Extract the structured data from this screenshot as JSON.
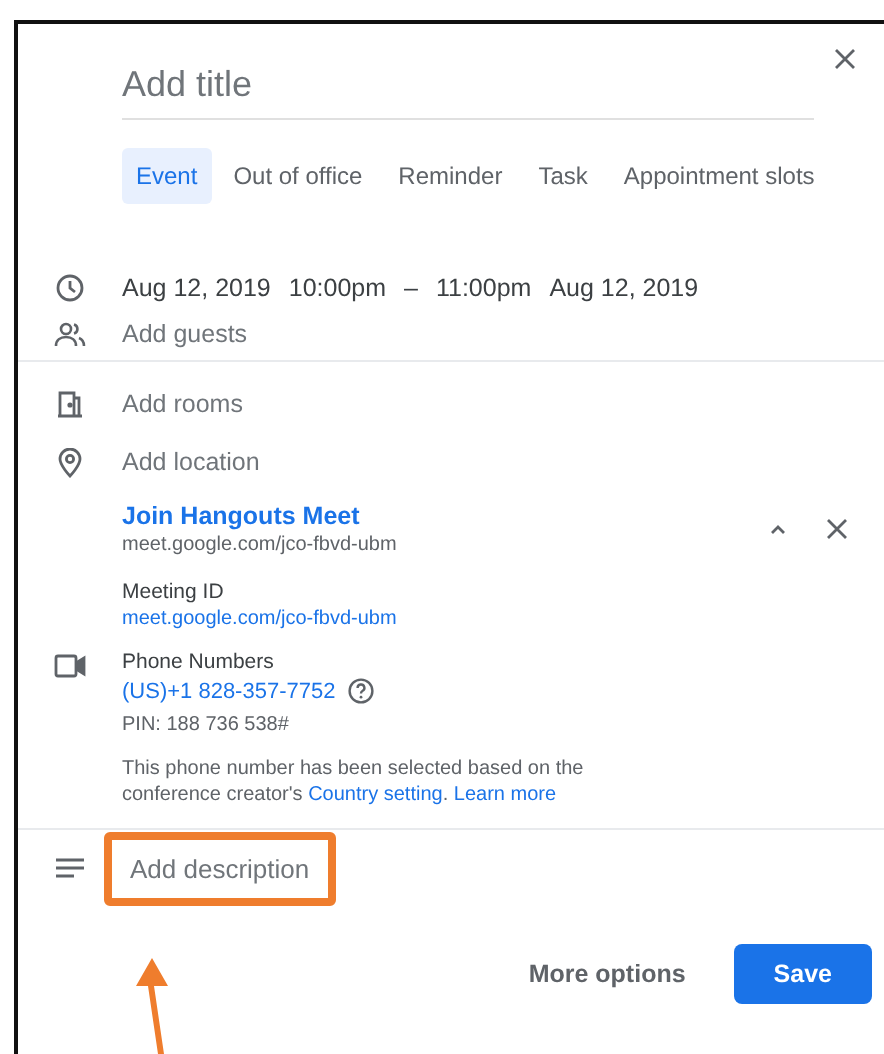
{
  "dialog": {
    "title_placeholder": "Add title",
    "event_types": [
      {
        "label": "Event",
        "selected": true
      },
      {
        "label": "Out of office",
        "selected": false
      },
      {
        "label": "Reminder",
        "selected": false
      },
      {
        "label": "Task",
        "selected": false
      },
      {
        "label": "Appointment slots",
        "selected": false
      }
    ],
    "when": {
      "start_date": "Aug 12, 2019",
      "start_time": "10:00pm",
      "separator": "–",
      "end_time": "11:00pm",
      "end_date": "Aug 12, 2019"
    },
    "guests_placeholder": "Add guests",
    "rooms_placeholder": "Add rooms",
    "location_placeholder": "Add location",
    "conference": {
      "join_label": "Join Hangouts Meet",
      "url": "meet.google.com/jco-fbvd-ubm",
      "meeting_id_label": "Meeting ID",
      "meeting_id": "meet.google.com/jco-fbvd-ubm",
      "phone_label": "Phone Numbers",
      "phone": "(US)+1 828-357-7752",
      "pin": "PIN: 188 736 538#",
      "note_parts": [
        {
          "kind": "plain",
          "text": "This phone number has been selected based on the conference creator's "
        },
        {
          "kind": "link",
          "text": "Country setting"
        },
        {
          "kind": "plain",
          "text": ". "
        },
        {
          "kind": "link",
          "text": "Learn more"
        }
      ]
    },
    "description": {
      "placeholder": "Add description",
      "highlighted": true
    },
    "buttons": [
      {
        "label": "More options",
        "kind": "text"
      },
      {
        "label": "Save",
        "kind": "primary"
      }
    ]
  }
}
